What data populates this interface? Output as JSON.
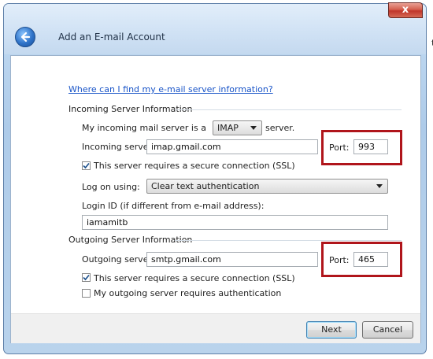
{
  "window": {
    "title": "Add an E-mail Account",
    "close_glyph": "x"
  },
  "background_fragment": "t",
  "help_link": "Where can I find my e-mail server information?",
  "incoming": {
    "section_title": "Incoming Server Information",
    "type_prefix": "My incoming mail server is a",
    "type_value": "IMAP",
    "type_suffix": "server.",
    "server_label": "Incoming server:",
    "server_value": "imap.gmail.com",
    "port_label": "Port:",
    "port_value": "993",
    "ssl_label": "This server requires a secure connection (SSL)",
    "ssl_checked": true,
    "logon_label": "Log on using:",
    "logon_value": "Clear text authentication",
    "login_id_label": "Login ID (if different from e-mail address):",
    "login_id_value": "iamamitb"
  },
  "outgoing": {
    "section_title": "Outgoing Server Information",
    "server_label": "Outgoing server:",
    "server_value": "smtp.gmail.com",
    "port_label": "Port:",
    "port_value": "465",
    "ssl_label": "This server requires a secure connection (SSL)",
    "ssl_checked": true,
    "auth_label": "My outgoing server requires authentication",
    "auth_checked": false
  },
  "buttons": {
    "next": "Next",
    "cancel": "Cancel"
  },
  "colors": {
    "highlight_box": "#b0151b",
    "link": "#1a55c8"
  }
}
